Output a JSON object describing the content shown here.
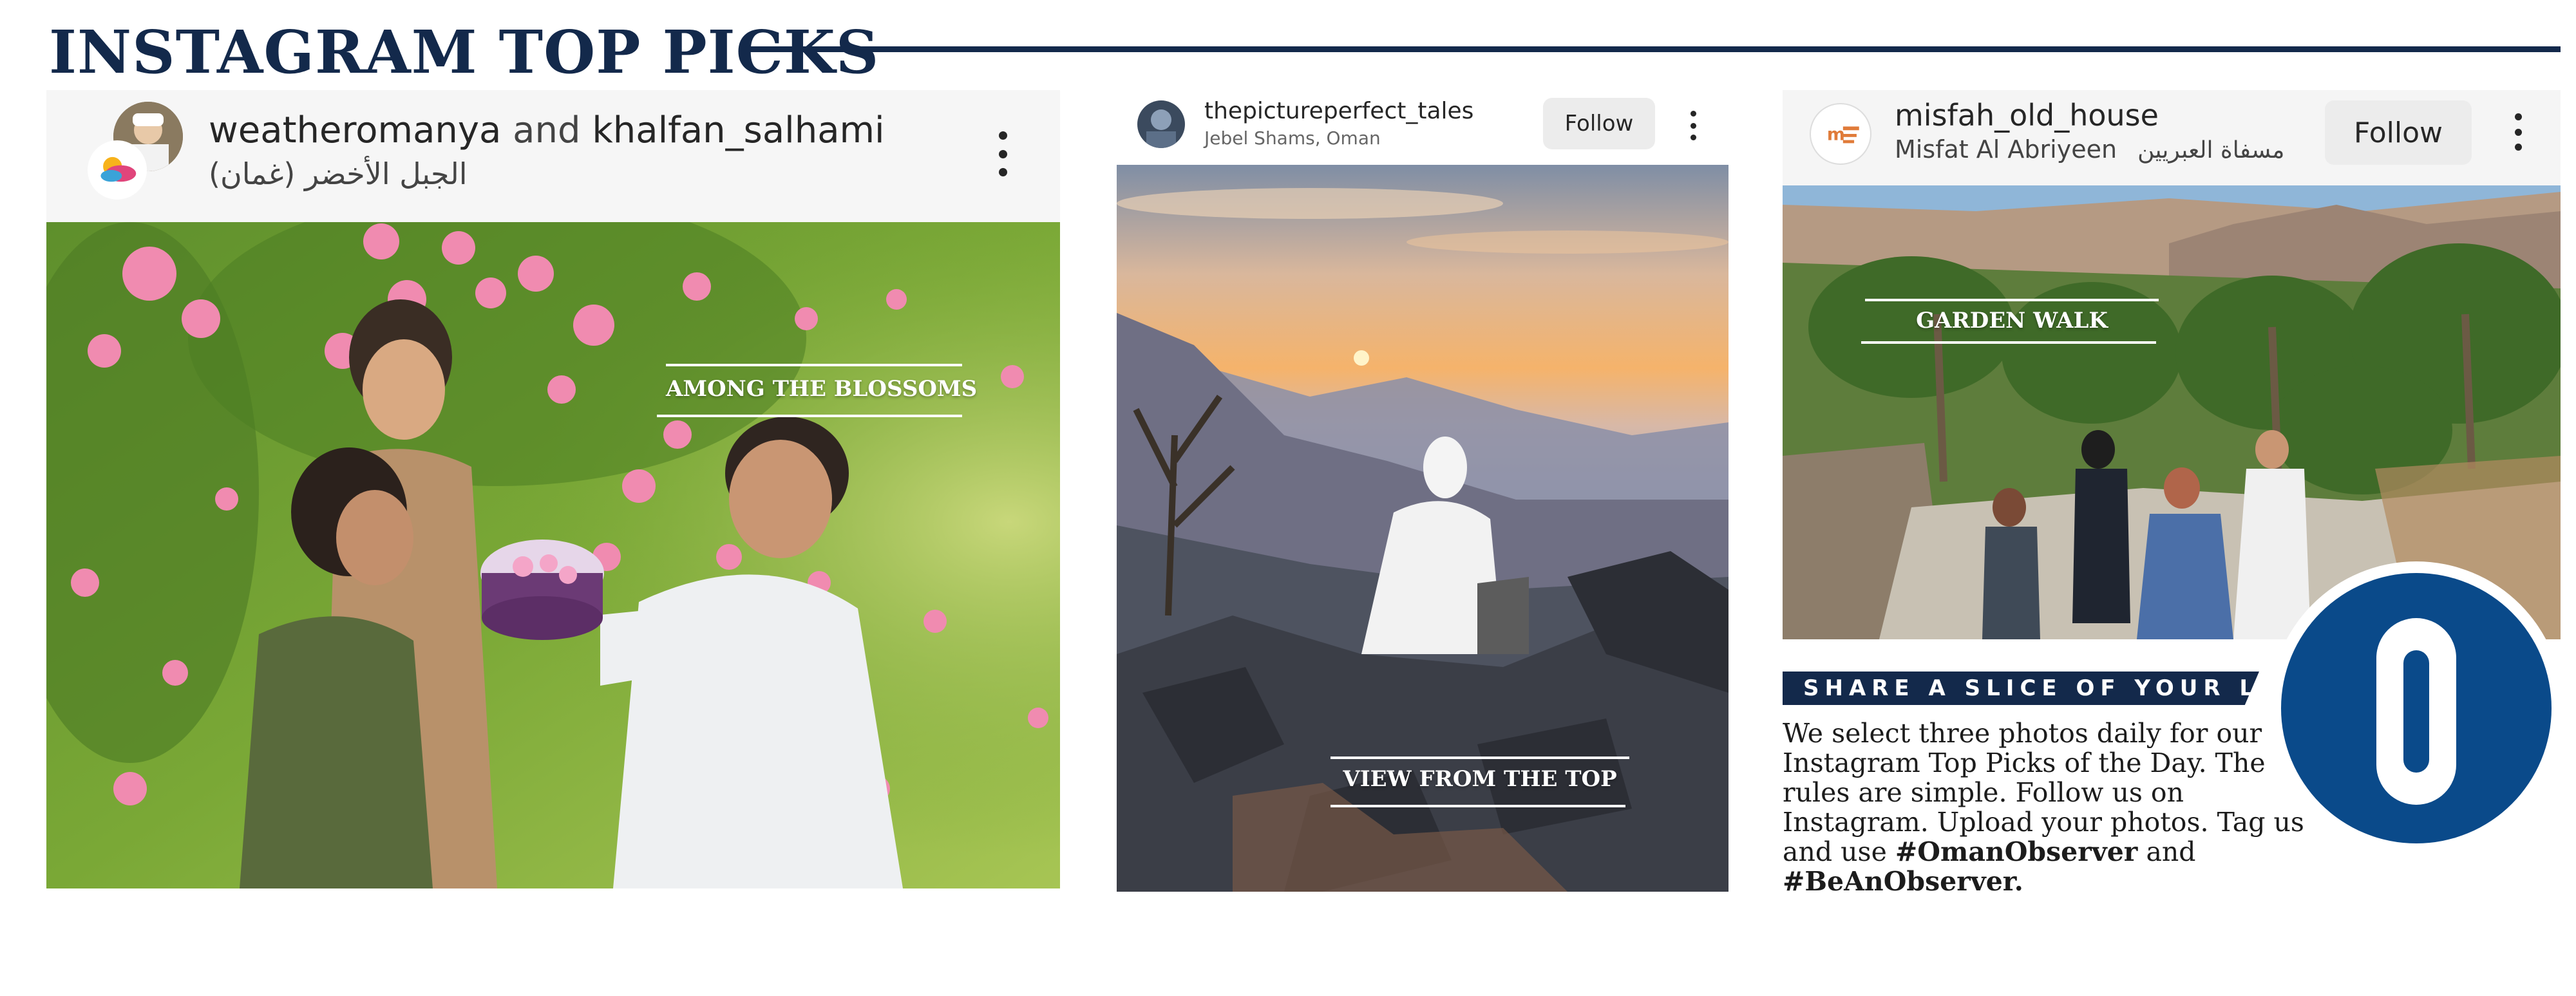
{
  "header": {
    "title": "INSTAGRAM TOP PICKS"
  },
  "posts": [
    {
      "user_a": "weatheromanya",
      "joiner": "and",
      "user_b": "khalfan_salhami",
      "location": "الجبل الأخضر (غمان)",
      "caption": "AMONG THE BLOSSOMS"
    },
    {
      "user": "thepictureperfect_tales",
      "location": "Jebel Shams, Oman",
      "follow": "Follow",
      "caption": "VIEW FROM THE TOP"
    },
    {
      "user": "misfah_old_house",
      "location": "Misfat Al Abriyeen",
      "location_ar": "مسفاة العبريين",
      "follow": "Follow",
      "caption": "GARDEN WALK"
    }
  ],
  "promo": {
    "heading": "SHARE A SLICE OF YOUR LIFE",
    "body": "We select three photos daily for our Instagram Top Picks of the Day. The rules are simple. Follow us on Instagram. Upload your photos. Tag us and use",
    "tag1": "#OmanObserver",
    "and": "and",
    "tag2": "#BeAnObserver."
  },
  "logo": {
    "letter": "O",
    "color": "#0a4a8a"
  }
}
